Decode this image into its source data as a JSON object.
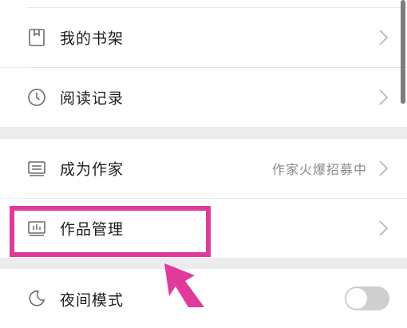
{
  "menu": {
    "items": [
      {
        "label": "我的书架",
        "icon": "bookmark-icon"
      },
      {
        "label": "阅读记录",
        "icon": "clock-icon"
      },
      {
        "label": "成为作家",
        "icon": "document-lines-icon",
        "extra": "作家火爆招募中"
      },
      {
        "label": "作品管理",
        "icon": "chart-icon"
      },
      {
        "label": "夜间模式",
        "icon": "moon-icon",
        "toggle": false
      }
    ]
  },
  "annotation": {
    "highlight_color": "#e03a9c",
    "arrow_color": "#e03a9c"
  }
}
